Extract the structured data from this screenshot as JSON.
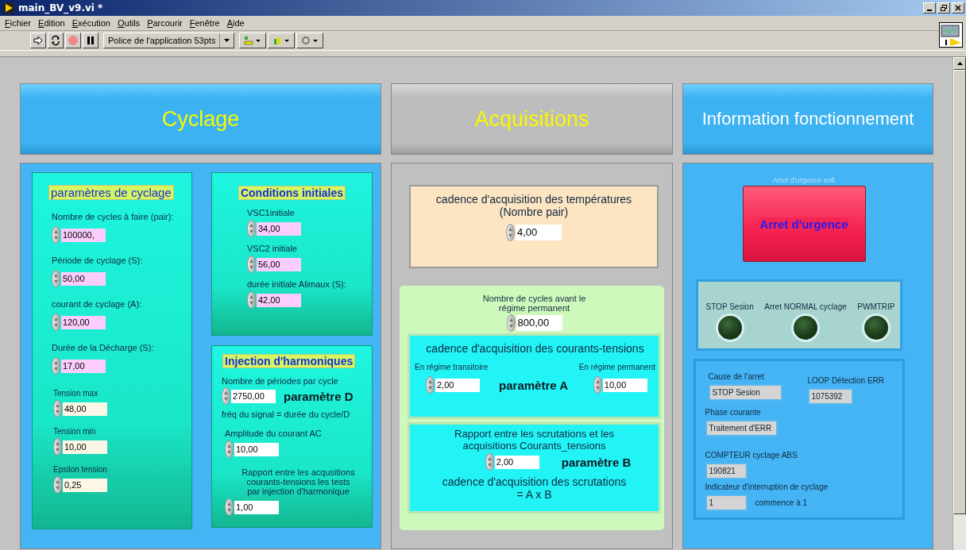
{
  "window": {
    "title": "main_BV_v9.vi *"
  },
  "menu": [
    "Fichier",
    "Edition",
    "Exécution",
    "Outils",
    "Parcourir",
    "Fenêtre",
    "Aide"
  ],
  "toolbar": {
    "font": "Police de l'application 53pts"
  },
  "cyclage": {
    "header": "Cyclage",
    "parametres": {
      "title": "paramètres de cyclage",
      "controls": [
        {
          "label": "Nombre de cycles à faire (pair):",
          "value": "100000,"
        },
        {
          "label": "Période de cyclage (S):",
          "value": "50,00"
        },
        {
          "label": "courant de cyclage (A):",
          "value": "120,00"
        },
        {
          "label": "Durée de la Décharge (S):",
          "value": "17,00"
        }
      ],
      "limits": [
        {
          "label": "Tension max",
          "value": "48,00"
        },
        {
          "label": "Tension min",
          "value": "10,00"
        },
        {
          "label": "Epsilon tension",
          "value": "0,25"
        }
      ]
    },
    "conditions": {
      "title": "Conditions initiales",
      "controls": [
        {
          "label": "VSC1initiale",
          "value": "34,00"
        },
        {
          "label": "VSC2 initiale",
          "value": "56,00"
        },
        {
          "label": "durée initiale Alimaux (S):",
          "value": "42,00"
        }
      ]
    },
    "injection": {
      "title": "Injection d'harmoniques",
      "periods": {
        "label": "Nombre de périodes par cycle",
        "value": "2750,00",
        "parameter": "paramètre D"
      },
      "formula": "fréq du signal = durée du cycle/D",
      "amplitude": {
        "label": "Amplitude du courant AC",
        "value": "10,00"
      },
      "ratio": {
        "label": "Rapport entre les acqusitions\ncourants-tensions les tests\npar injection d'harmonique",
        "value": "1,00"
      }
    }
  },
  "acquisitions": {
    "header": "Acquisitions",
    "temperature": {
      "label": "cadence d'acquisition des températures\n(Nombre pair)",
      "value": "4,00"
    },
    "cycles_before": {
      "label": "Nombre de cycles avant le\nrégime permanent",
      "value": "800,00"
    },
    "currents": {
      "title": "cadence d'acquisition des courants-tensions",
      "transitoire": {
        "label": "En régime transitoire",
        "value": "2,00"
      },
      "parameter": "paramètre A",
      "permanent": {
        "label": "En régime permanent",
        "value": "10,00"
      }
    },
    "scan": {
      "label": "Rapport entre les scrutations et les\nacquisitions Courants_tensions",
      "value": "2,00",
      "parameter": "paramètre B",
      "result": "cadence d'acquisition des scrutations\n= A x B"
    }
  },
  "information": {
    "header": "Information fonctionnement",
    "emergency": {
      "caption": "Arret d'urgence soft",
      "label": "Arret d'urgence"
    },
    "leds": [
      {
        "label": "STOP Sesion",
        "on": false
      },
      {
        "label": "Arret NORMAL cyclage",
        "on": false
      },
      {
        "label": "PWMTRIP",
        "on": false
      }
    ],
    "cause": {
      "label": "Cause de l'arret",
      "value": "STOP Sesion"
    },
    "loop": {
      "label": "LOOP Détection ERR",
      "value": "1075392"
    },
    "phase": {
      "label": "Phase courante",
      "value": "Traitement d'ERR"
    },
    "counter": {
      "label": "COMPTEUR cyclage ABS",
      "value": "190821"
    },
    "interrupt": {
      "label": "Indicateur d'interruption de cyclage",
      "value": "1",
      "note": "commence à 1"
    }
  }
}
